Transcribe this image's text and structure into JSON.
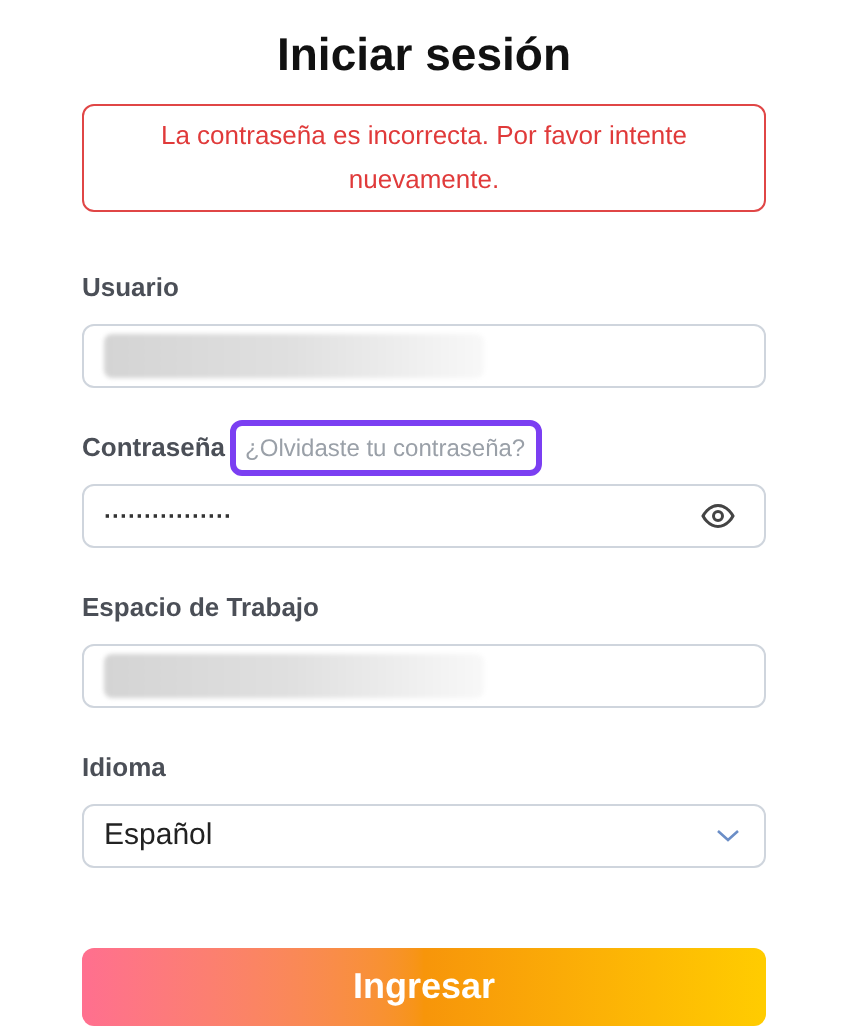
{
  "title": "Iniciar sesión",
  "error": "La contraseña es incorrecta. Por favor intente nuevamente.",
  "fields": [
    {
      "kind": "text",
      "label": "Usuario",
      "redacted": true
    },
    {
      "kind": "password",
      "label": "Contraseña",
      "link": {
        "label": "¿Olvidaste tu contraseña?",
        "highlighted": true
      },
      "value": "················"
    },
    {
      "kind": "text",
      "label": "Espacio de Trabajo",
      "redacted": true
    },
    {
      "kind": "select",
      "label": "Idioma",
      "value": "Español"
    }
  ],
  "submit": "Ingresar"
}
